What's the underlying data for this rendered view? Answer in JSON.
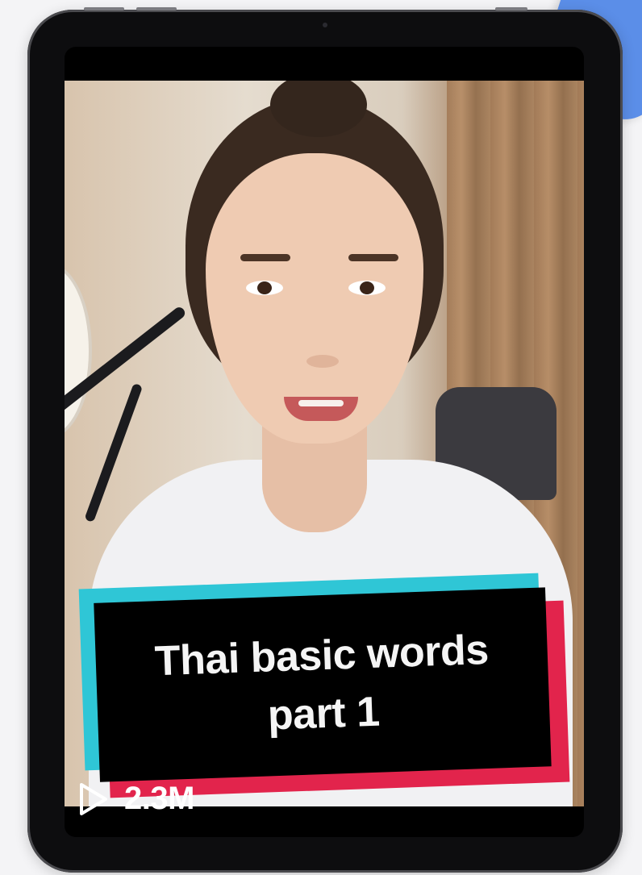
{
  "video": {
    "caption_line_1": "Thai basic words",
    "caption_line_2": "part 1",
    "view_count": "2.3M",
    "play_icon": "play-outline-icon"
  },
  "colors": {
    "caption_background": "#000000",
    "caption_accent_cyan": "#2fc6d6",
    "caption_accent_red": "#e2244c",
    "device_frame": "#0d0d0f",
    "page_background": "#f4f4f6",
    "corner_accent": "#5b8ee8"
  }
}
